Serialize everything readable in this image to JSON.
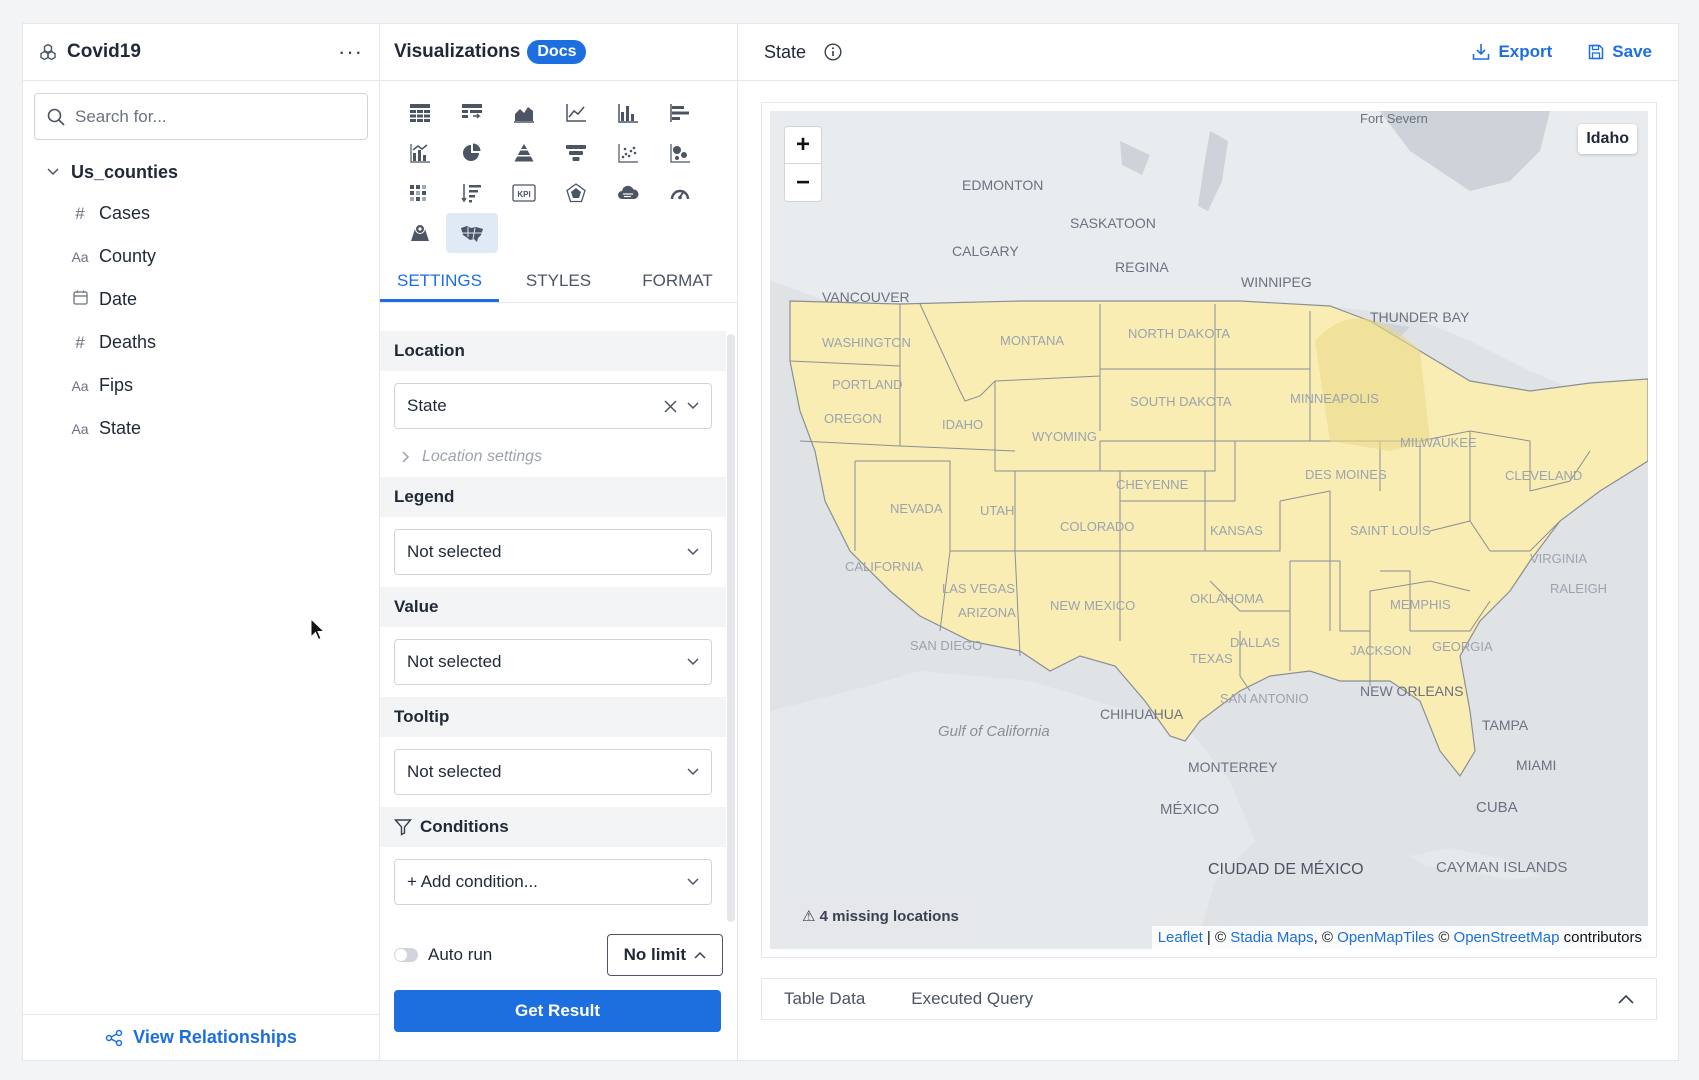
{
  "left": {
    "title": "Covid19",
    "more": "···",
    "search_placeholder": "Search for...",
    "table": "Us_counties",
    "fields": [
      {
        "type_icon": "#",
        "name": "Cases"
      },
      {
        "type_icon": "Aa",
        "name": "County"
      },
      {
        "type_icon": "calendar",
        "name": "Date"
      },
      {
        "type_icon": "#",
        "name": "Deaths"
      },
      {
        "type_icon": "Aa",
        "name": "Fips"
      },
      {
        "type_icon": "Aa",
        "name": "State"
      }
    ],
    "footer": "View Relationships"
  },
  "mid": {
    "title": "Visualizations",
    "docs": "Docs",
    "kpi_label": "KPI",
    "tabs": [
      "SETTINGS",
      "STYLES",
      "FORMAT"
    ],
    "location": {
      "label": "Location",
      "value": "State",
      "sub": "Location settings"
    },
    "legend": {
      "label": "Legend",
      "value": "Not selected"
    },
    "value": {
      "label": "Value",
      "value": "Not selected"
    },
    "tooltip": {
      "label": "Tooltip",
      "value": "Not selected"
    },
    "conditions": {
      "label": "Conditions",
      "value": "+ Add condition..."
    },
    "auto_run": "Auto run",
    "limit": "No limit",
    "get_result": "Get Result"
  },
  "right": {
    "title": "State",
    "export": "Export",
    "save": "Save",
    "hover_label": "Idaho",
    "missing": "4 missing locations",
    "attribution": {
      "leaflet": "Leaflet",
      "sep1": " | © ",
      "stadia": "Stadia Maps",
      "sep2": ", © ",
      "omt": "OpenMapTiles",
      "sep3": " © ",
      "osm": "OpenStreetMap",
      "tail": " contributors"
    },
    "bottom_tabs": [
      "Table Data",
      "Executed Query"
    ],
    "map_labels": {
      "edmonton": "EDMONTON",
      "saskatoon": "SASKATOON",
      "calgary": "CALGARY",
      "regina": "REGINA",
      "winnipeg": "WINNIPEG",
      "vancouver": "VANCOUVER",
      "thunder_bay": "THUNDER BAY",
      "fort_severn": "Fort Severn",
      "washington": "WASHINGTON",
      "montana": "MONTANA",
      "north_dakota": "NORTH DAKOTA",
      "south_dakota": "SOUTH DAKOTA",
      "portland": "PORTLAND",
      "oregon": "OREGON",
      "idaho": "IDAHO",
      "wyoming": "WYOMING",
      "minneapolis": "MINNEAPOLIS",
      "milwaukee": "MILWAUKEE",
      "des_moines": "DES MOINES",
      "cheyenne": "CHEYENNE",
      "nevada": "NEVADA",
      "utah": "UTAH",
      "colorado": "COLORADO",
      "kansas": "KANSAS",
      "saint_louis": "SAINT LOUIS",
      "cleveland": "CLEVELAND",
      "california": "CALIFORNIA",
      "las_vegas": "LAS VEGAS",
      "arizona": "ARIZONA",
      "new_mexico": "NEW MEXICO",
      "oklahoma": "OKLAHOMA",
      "memphis": "MEMPHIS",
      "virginia": "VIRGINIA",
      "raleigh": "RALEIGH",
      "san_diego": "SAN DIEGO",
      "dallas": "DALLAS",
      "texas": "TEXAS",
      "jackson": "JACKSON",
      "georgia": "GEORGIA",
      "san_antonio": "SAN ANTONIO",
      "new_orleans": "NEW ORLEANS",
      "chihuahua": "CHIHUAHUA",
      "gulf": "Gulf of California",
      "monterrey": "MONTERREY",
      "tampa": "TAMPA",
      "miami": "MIAMI",
      "mexico": "MÉXICO",
      "cuba": "CUBA",
      "cdmx": "CIUDAD DE MÉXICO",
      "cayman": "CAYMAN ISLANDS"
    }
  }
}
